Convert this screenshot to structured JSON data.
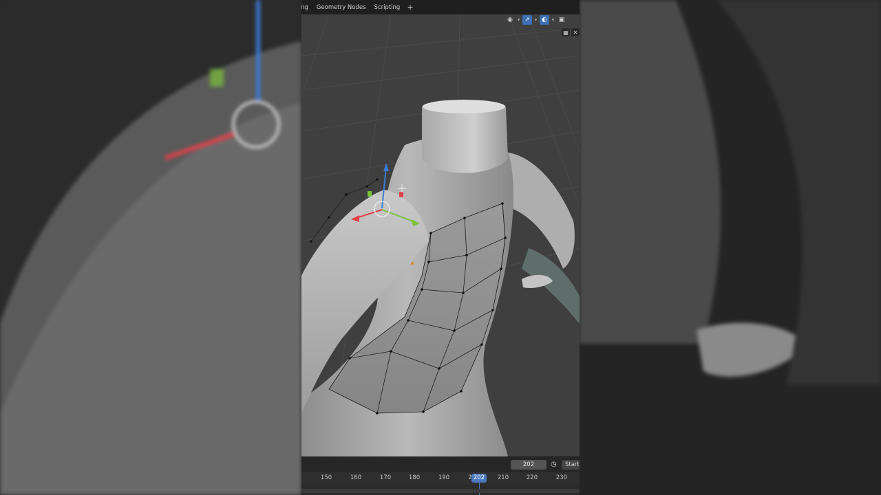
{
  "workspace_tabs": [
    {
      "label": "ng",
      "cut": true
    },
    {
      "label": "Geometry Nodes"
    },
    {
      "label": "Scripting"
    }
  ],
  "add_tab_label": "+",
  "viewport_header": {
    "icons": [
      "visibility-icon",
      "gizmo-icon",
      "overlay-icon",
      "xray-icon"
    ]
  },
  "timeline": {
    "current_frame": "202",
    "start_label": "Start",
    "playhead_label": "202",
    "ticks": [
      "150",
      "160",
      "170",
      "180",
      "190",
      "2",
      "210",
      "220",
      "230"
    ]
  },
  "colors": {
    "accent": "#3d6fb1",
    "x_axis": "#e0404a",
    "y_axis": "#7ac23a",
    "z_axis": "#3a7bd5"
  }
}
